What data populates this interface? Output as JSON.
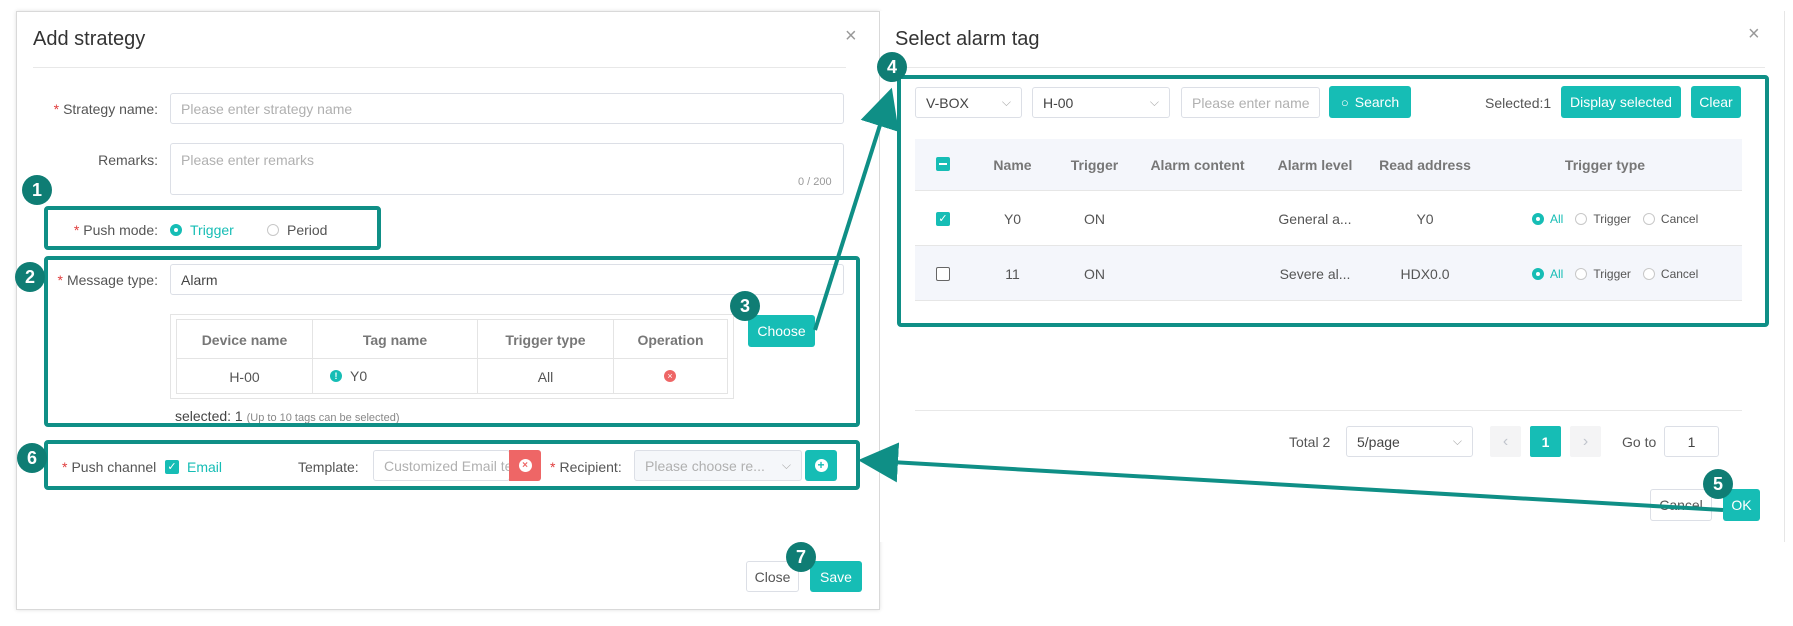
{
  "add_strategy": {
    "title": "Add strategy",
    "close": "×",
    "strategy_name": {
      "label": "Strategy name:",
      "placeholder": "Please enter strategy name"
    },
    "remarks": {
      "label": "Remarks:",
      "placeholder": "Please enter remarks",
      "counter": "0 / 200"
    },
    "push_mode": {
      "label": "Push mode:",
      "options": [
        "Trigger",
        "Period"
      ],
      "selected": "Trigger"
    },
    "message_type": {
      "label": "Message type:",
      "value": "Alarm"
    },
    "choose_button": "Choose",
    "tag_table": {
      "headers": [
        "Device name",
        "Tag name",
        "Trigger type",
        "Operation"
      ],
      "rows": [
        {
          "device": "H-00",
          "tag": "Y0",
          "trigger": "All"
        }
      ]
    },
    "selected_count": "selected: 1",
    "selected_hint": "(Up to 10 tags can be selected)",
    "push_channel": {
      "label": "Push channel",
      "email_label": "Email"
    },
    "template": {
      "label": "Template:",
      "value": "Customized Email te"
    },
    "recipient": {
      "label": "Recipient:",
      "placeholder": "Please choose re..."
    },
    "footer": {
      "close": "Close",
      "save": "Save"
    }
  },
  "select_alarm_tag": {
    "title": "Select alarm tag",
    "close": "×",
    "filters": {
      "box": "V-BOX",
      "device": "H-00",
      "name_placeholder": "Please enter name",
      "search": "Search"
    },
    "selected_label": "Selected:1",
    "display_selected": "Display selected",
    "clear": "Clear",
    "table": {
      "headers": [
        "Name",
        "Trigger",
        "Alarm content",
        "Alarm level",
        "Read address",
        "Trigger type"
      ],
      "rows": [
        {
          "name": "Y0",
          "trigger": "ON",
          "content": "",
          "level": "General a...",
          "address": "Y0",
          "checked": true
        },
        {
          "name": "11",
          "trigger": "ON",
          "content": "",
          "level": "Severe al...",
          "address": "HDX0.0",
          "checked": false
        }
      ],
      "trigger_options": [
        "All",
        "Trigger",
        "Cancel"
      ]
    },
    "pagination": {
      "total": "Total 2",
      "page_size": "5/page",
      "current_page": "1",
      "goto_label": "Go to",
      "goto_value": "1",
      "prev": "‹",
      "next": "›"
    },
    "footer": {
      "cancel": "Cancel",
      "ok": "OK"
    }
  },
  "badges": [
    "1",
    "2",
    "3",
    "4",
    "5",
    "6",
    "7"
  ],
  "colors": {
    "accent": "#16bdb5",
    "highlight": "#0f8f86",
    "required": "#e03c3c",
    "danger": "#ee6666"
  }
}
